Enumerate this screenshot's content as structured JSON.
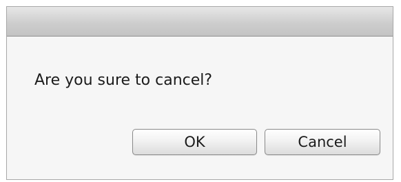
{
  "dialog": {
    "message": "Are you sure to cancel?",
    "ok_label": "OK",
    "cancel_label": "Cancel"
  }
}
